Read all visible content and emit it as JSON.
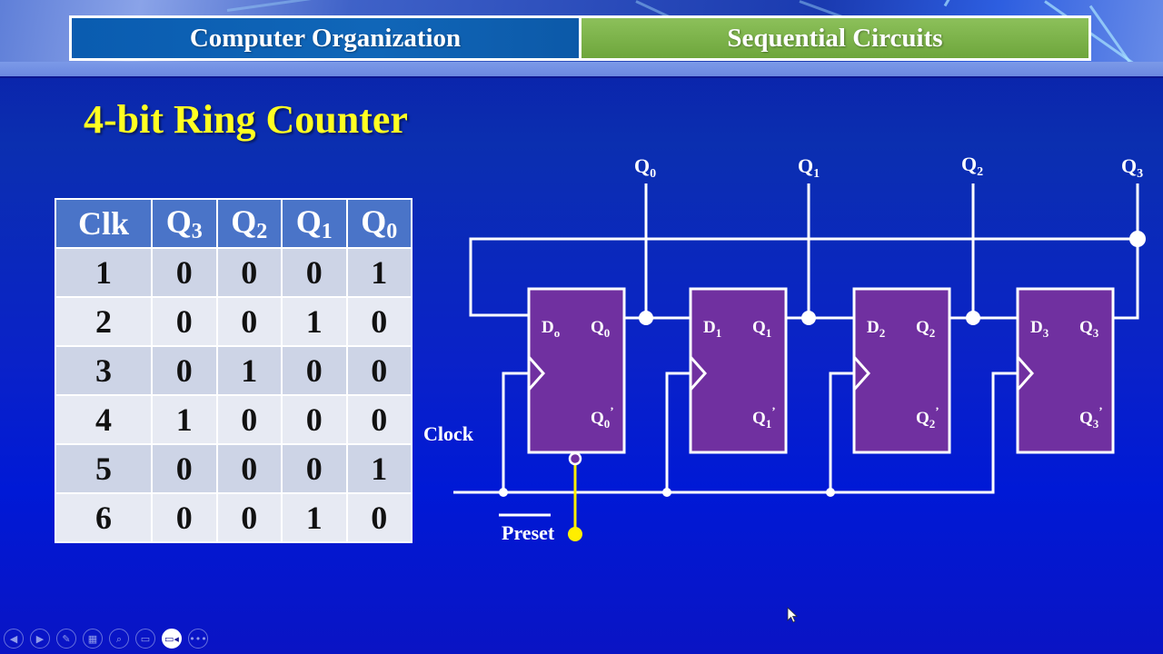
{
  "header": {
    "left_title": "Computer Organization",
    "right_title": "Sequential Circuits",
    "left_color": "#0a5cb0",
    "right_color": "#7ab348"
  },
  "slide": {
    "title": "4-bit Ring Counter",
    "title_color": "#ffff22"
  },
  "truth_table": {
    "headers": [
      {
        "main": "Clk",
        "sub": ""
      },
      {
        "main": "Q",
        "sub": "3"
      },
      {
        "main": "Q",
        "sub": "2"
      },
      {
        "main": "Q",
        "sub": "1"
      },
      {
        "main": "Q",
        "sub": "0"
      }
    ],
    "rows": [
      [
        "1",
        "0",
        "0",
        "0",
        "1"
      ],
      [
        "2",
        "0",
        "0",
        "1",
        "0"
      ],
      [
        "3",
        "0",
        "1",
        "0",
        "0"
      ],
      [
        "4",
        "1",
        "0",
        "0",
        "0"
      ],
      [
        "5",
        "0",
        "0",
        "0",
        "1"
      ],
      [
        "6",
        "0",
        "0",
        "1",
        "0"
      ]
    ]
  },
  "circuit": {
    "flipflop_color": "#7030a0",
    "preset_color": "#ffee00",
    "outputs": [
      {
        "main": "Q",
        "sub": "0"
      },
      {
        "main": "Q",
        "sub": "1"
      },
      {
        "main": "Q",
        "sub": "2"
      },
      {
        "main": "Q",
        "sub": "3"
      }
    ],
    "flipflops": [
      {
        "d": "D",
        "d_sub": "o",
        "q": "Q",
        "q_sub": "0",
        "qn": "Q",
        "qn_sub": "0",
        "qn_mark": "’"
      },
      {
        "d": "D",
        "d_sub": "1",
        "q": "Q",
        "q_sub": "1",
        "qn": "Q",
        "qn_sub": "1",
        "qn_mark": "’"
      },
      {
        "d": "D",
        "d_sub": "2",
        "q": "Q",
        "q_sub": "2",
        "qn": "Q",
        "qn_sub": "2",
        "qn_mark": "’"
      },
      {
        "d": "D",
        "d_sub": "3",
        "q": "Q",
        "q_sub": "3",
        "qn": "Q",
        "qn_sub": "3",
        "qn_mark": "’"
      }
    ],
    "clock_label": "Clock",
    "preset_label": "Preset"
  },
  "toolbar": {
    "buttons": [
      {
        "name": "previous-slide",
        "glyph": "◀"
      },
      {
        "name": "next-slide",
        "glyph": "▶"
      },
      {
        "name": "pen-tool",
        "glyph": "✎"
      },
      {
        "name": "see-all-slides",
        "glyph": "▦"
      },
      {
        "name": "zoom",
        "glyph": "⌕"
      },
      {
        "name": "subtitles",
        "glyph": "▭"
      },
      {
        "name": "camera",
        "glyph": "▭◂"
      },
      {
        "name": "more-options",
        "glyph": "•••"
      }
    ]
  }
}
